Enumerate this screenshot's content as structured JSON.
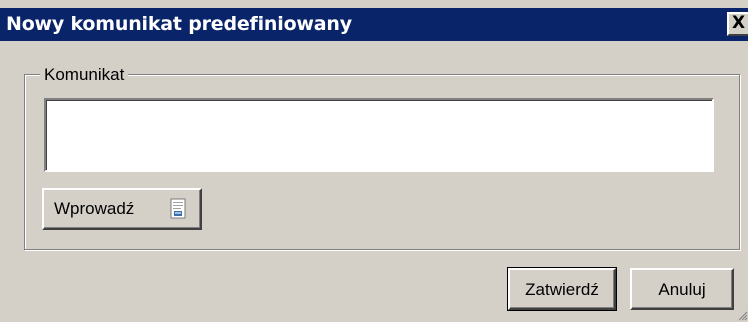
{
  "window": {
    "title": "Nowy komunikat predefiniowany",
    "close_label": "X"
  },
  "group": {
    "label": "Komunikat"
  },
  "message_input": {
    "value": "",
    "placeholder": ""
  },
  "buttons": {
    "enter_label": "Wprowadź",
    "enter_icon": "document-icon",
    "confirm_label": "Zatwierdź",
    "cancel_label": "Anuluj"
  },
  "colors": {
    "titlebar": "#0a246a",
    "title_text": "#ffffff",
    "window_bg": "#d4d0c8",
    "input_bg": "#ffffff"
  }
}
